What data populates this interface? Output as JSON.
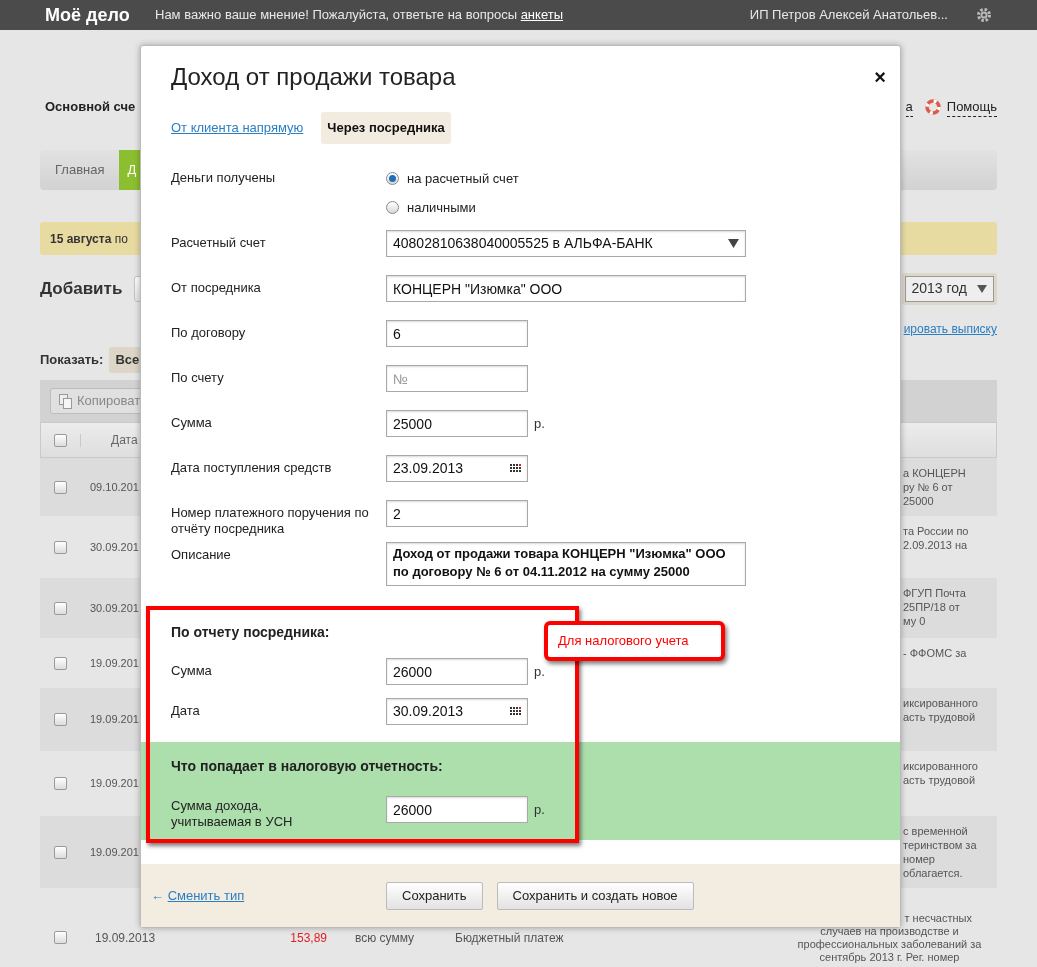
{
  "topbar": {
    "logo": "Моё дело",
    "notice": "Нам важно ваше мнение! Пожалуйста, ответьте на вопросы",
    "notice_link": "анкеты",
    "user": "ИП Петров Алексей Анатольев..."
  },
  "background": {
    "account_title": "Основной сче",
    "right_link": "а",
    "help": "Помощь",
    "nav_tabs": [
      {
        "label": "Главная",
        "selected": false
      },
      {
        "label": "Д",
        "selected": true
      }
    ],
    "banner": "**15 августа** по",
    "add_label": "Добавить",
    "year_select": "2013 год",
    "export_link": "ировать выписку",
    "show_label": "Показать:",
    "show_filter": "Все",
    "copy_button": "Копироват",
    "date_header": "Дата",
    "header_checked": false,
    "rows": [
      {
        "date": "09.10.201",
        "checked": false,
        "desc": [
          "а КОНЦЕРН",
          "ру № 6 от",
          "25000"
        ]
      },
      {
        "date": "30.09.201",
        "checked": false,
        "desc": [
          "та России по",
          "2.09.2013 на"
        ]
      },
      {
        "date": "30.09.201",
        "checked": false,
        "desc": [
          "ФГУП Почта",
          "25ПР/18 от",
          "му 0"
        ]
      },
      {
        "date": "19.09.201",
        "checked": false,
        "desc": [
          "- ФФОМС за"
        ]
      },
      {
        "date": "19.09.201",
        "checked": false,
        "desc": [
          "иксированного",
          "асть трудовой"
        ]
      },
      {
        "date": "19.09.201",
        "checked": false,
        "desc": [
          "иксированного",
          "асть трудовой"
        ]
      },
      {
        "date": "19.09.201",
        "checked": false,
        "desc": [
          "с временной",
          "теринством за",
          "номер",
          "облагается."
        ]
      }
    ],
    "last_row": {
      "date": "19.09.2013",
      "checked": false,
      "amount": "153,89",
      "part": "всю сумму",
      "type": "Бюджетный платеж",
      "desc_top": "т несчастных",
      "desc": [
        "случаев на производстве и",
        "профессиональных заболеваний за",
        "сентябрь 2013 г. Рег. номер"
      ]
    }
  },
  "dialog": {
    "title": "Доход от продажи товара",
    "close": "×",
    "tabs": [
      {
        "label": "От клиента напрямую",
        "selected": false
      },
      {
        "label": "Через посредника",
        "selected": true
      }
    ],
    "fields": [
      {
        "kind": "radio",
        "label": "Деньги получены",
        "options": [
          {
            "label": "на расчетный счет",
            "selected": true
          },
          {
            "label": "наличными",
            "selected": false
          }
        ]
      },
      {
        "kind": "select",
        "label": "Расчетный счет",
        "value": "40802810638040005525 в АЛЬФА-БАНК"
      },
      {
        "kind": "wide",
        "label": "От посредника",
        "value": "КОНЦЕРН \"Изюмка\" ООО"
      },
      {
        "kind": "input",
        "label": "По договору",
        "value": "6"
      },
      {
        "kind": "input",
        "label": "По счету",
        "placeholder": "№"
      },
      {
        "kind": "input",
        "label": "Сумма",
        "value": "25000",
        "suffix": "р."
      },
      {
        "kind": "date",
        "label": "Дата поступления средств",
        "value": "23.09.2013"
      },
      {
        "kind": "input",
        "label": "Номер платежного поручения по отчёту посредника",
        "value": "2"
      },
      {
        "kind": "textarea",
        "label": "Описание",
        "value": "Доход от продажи товара КОНЦЕРН \"Изюмка\" ООО по договору № 6 от 04.11.2012 на сумму 25000"
      }
    ],
    "report": {
      "heading": "По отчету посредника:",
      "fields": [
        {
          "kind": "input",
          "label": "Сумма",
          "value": "26000",
          "suffix": "р."
        },
        {
          "kind": "date",
          "label": "Дата",
          "value": "30.09.2013"
        }
      ]
    },
    "callout": "Для налогового учета",
    "tax": {
      "heading": "Что попадает в налоговую отчетность:",
      "fields": [
        {
          "kind": "input",
          "label": "Сумма дохода, учитываемая в УСН",
          "value": "26000",
          "suffix": "р."
        }
      ]
    },
    "footer": {
      "back_link": "Сменить тип",
      "back_arrow": "←",
      "buttons": [
        "Сохранить",
        "Сохранить и создать новое"
      ]
    }
  }
}
